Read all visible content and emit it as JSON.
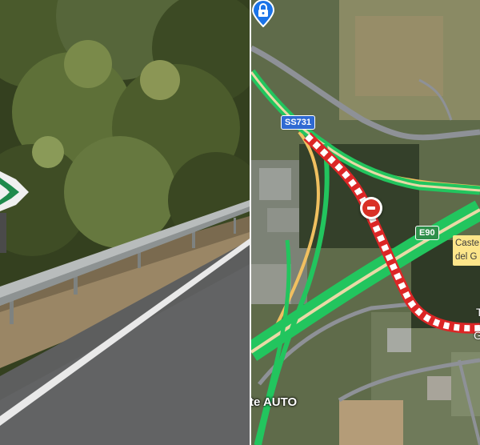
{
  "colors": {
    "highway_green": "#22c55e",
    "closed_road_red": "#dc2626",
    "route_shield_blue": "#2f6ad3",
    "route_shield_green": "#2e8f4a",
    "poi_blue": "#1a73e8",
    "place_label_bg": "#fde68a"
  },
  "street_view": {
    "description_icon": "road-sign-icon"
  },
  "map": {
    "route_shields": {
      "ss731": "SS731",
      "e90": "E90"
    },
    "closure_icon": "no-entry-icon",
    "place_label": {
      "line1": "Caste",
      "line2": "del G"
    },
    "edge_labels": {
      "t1": "T",
      "t2": "G"
    },
    "poi": {
      "label": "te AUTO",
      "icon": "parking-lock-icon"
    }
  }
}
